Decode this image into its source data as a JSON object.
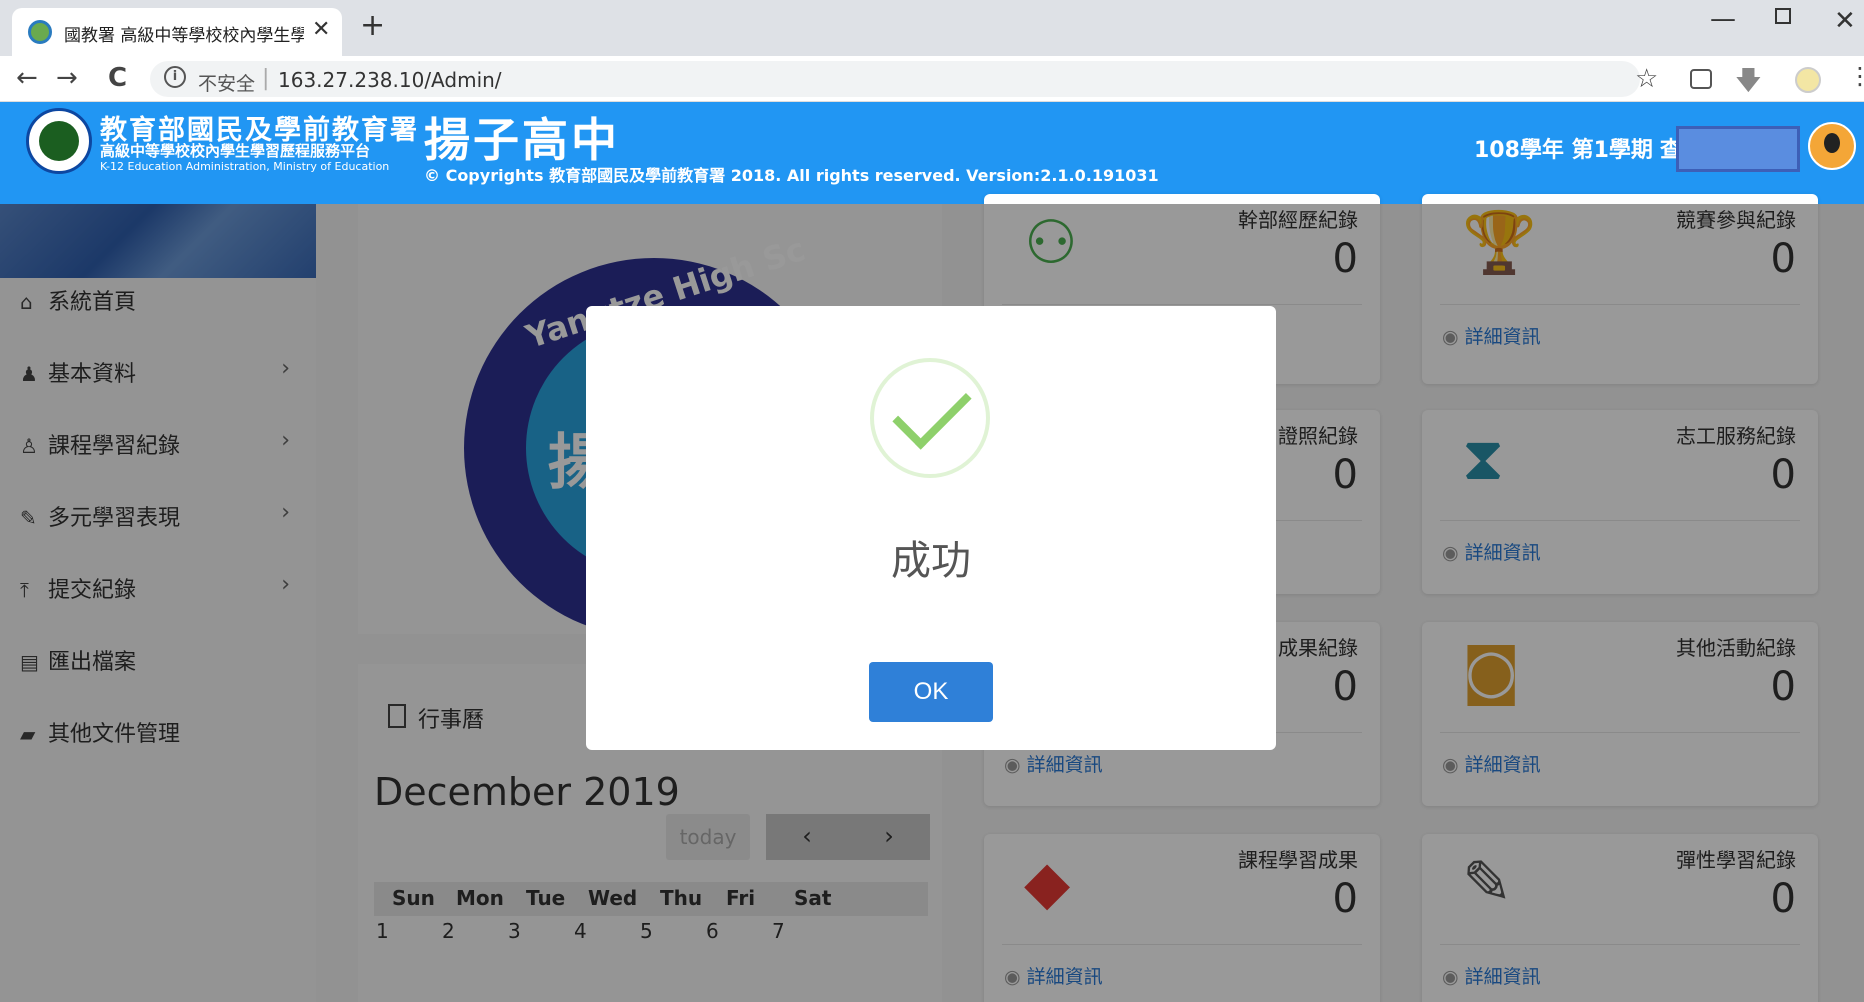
{
  "browser": {
    "tab_title": "國教署 高級中等學校校內學生學",
    "tab_close": "✕",
    "new_tab": "+",
    "insecure_label": "不安全",
    "address": "163.27.238.10/Admin/",
    "nav_back": "←",
    "nav_forward": "→",
    "nav_reload": "C",
    "minimize": "—",
    "close": "✕",
    "star": "☆",
    "menu": "⋮",
    "ext_download": "🡇"
  },
  "header": {
    "agency_title": "教育部國民及學前教育署",
    "platform_title": "高級中等學校校內學生學習歷程服務平台",
    "platform_english": "K-12 Education Administration, Ministry of Education",
    "school_name": "揚子高中",
    "copyright": "© Copyrights 教育部國民及學前教育署 2018. All rights reserved.    Version:2.1.0.191031",
    "semester": "108學年 第1學期",
    "user_partial": "查"
  },
  "sidebar": {
    "items": [
      {
        "label": "系統首頁",
        "icon": "home-icon",
        "glyph": "⌂",
        "arrow": ""
      },
      {
        "label": "基本資料",
        "icon": "user-icon",
        "glyph": "♟",
        "arrow": "›"
      },
      {
        "label": "課程學習紀錄",
        "icon": "person-outline-icon",
        "glyph": "♙",
        "arrow": "›"
      },
      {
        "label": "多元學習表現",
        "icon": "brush-icon",
        "glyph": "✎",
        "arrow": "›"
      },
      {
        "label": "提交紀錄",
        "icon": "upload-icon",
        "glyph": "⤒",
        "arrow": "›"
      },
      {
        "label": "匯出檔案",
        "icon": "file-icon",
        "glyph": "▤",
        "arrow": ""
      },
      {
        "label": "其他文件管理",
        "icon": "book-icon",
        "glyph": "▰",
        "arrow": ""
      }
    ]
  },
  "seal": {
    "ring_text": "Yangtze High Sc",
    "center_char": "揚"
  },
  "calendar": {
    "title": "行事曆",
    "month": "December 2019",
    "today_label": "today",
    "prev": "‹",
    "next": "›",
    "days_of_week": [
      "Sun",
      "Mon",
      "Tue",
      "Wed",
      "Thu",
      "Fri",
      "Sat"
    ],
    "first_week": [
      "1",
      "2",
      "3",
      "4",
      "5",
      "6",
      "7"
    ]
  },
  "cards": [
    {
      "title": "幹部經歷紀錄",
      "value": "0",
      "icon": "people-icon",
      "glyph": "⚇",
      "color": "#4caf50",
      "detail": ""
    },
    {
      "title": "競賽參與紀錄",
      "value": "0",
      "icon": "trophy-icon",
      "glyph": "🏆",
      "color": "#d4a017",
      "detail": "詳細資訊"
    },
    {
      "title": "證照紀錄",
      "value": "0",
      "icon": "certificate-icon",
      "glyph": "",
      "color": "#333333",
      "detail": ""
    },
    {
      "title": "志工服務紀錄",
      "value": "0",
      "icon": "hourglass-icon",
      "glyph": "⧗",
      "color": "#2a8fa8",
      "detail": "詳細資訊"
    },
    {
      "title": "成果紀錄",
      "value": "0",
      "icon": "result-icon",
      "glyph": "",
      "color": "#333333",
      "detail": "詳細資訊"
    },
    {
      "title": "其他活動紀錄",
      "value": "0",
      "icon": "camera-icon",
      "glyph": "◙",
      "color": "#e0a030",
      "detail": "詳細資訊"
    },
    {
      "title": "課程學習成果",
      "value": "0",
      "icon": "diamond-icon",
      "glyph": "◆",
      "color": "#e53935",
      "detail": "詳細資訊"
    },
    {
      "title": "彈性學習紀錄",
      "value": "0",
      "icon": "pencil-icon",
      "glyph": "✎",
      "color": "#555555",
      "detail": "詳細資訊"
    }
  ],
  "dialog": {
    "title": "成功",
    "ok_label": "OK"
  }
}
